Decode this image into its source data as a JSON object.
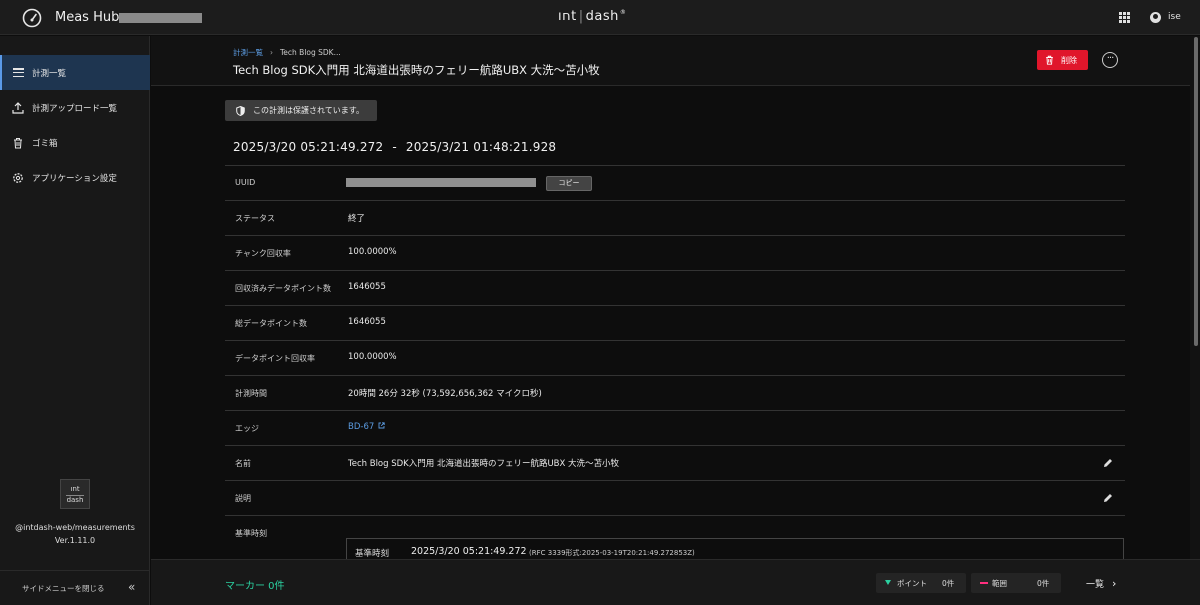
{
  "topbar": {
    "app_title": "Meas Hub",
    "logo_left": "ıחt",
    "logo_right": "dash",
    "user_name": "ise",
    "icons": [
      "gauge-icon",
      "app-grid-icon",
      "user-icon"
    ]
  },
  "sidebar": {
    "items": [
      {
        "label": "計測一覧",
        "icon": "hamburger-icon",
        "active": true
      },
      {
        "label": "計測アップロード一覧",
        "icon": "upload-icon",
        "active": false
      },
      {
        "label": "ゴミ箱",
        "icon": "trash-icon",
        "active": false
      },
      {
        "label": "アプリケーション設定",
        "icon": "gear-icon",
        "active": false
      }
    ],
    "logo_top": "ıחt",
    "logo_bottom": "dash",
    "package": "@intdash-web/measurements",
    "version": "Ver.1.11.0",
    "close_label": "サイドメニューを閉じる",
    "close_icon": "double-chevron-left-icon"
  },
  "header": {
    "breadcrumb_root": "計測一覧",
    "breadcrumb_current": "Tech Blog SDK...",
    "title": "Tech Blog SDK入門用 北海道出張時のフェリー航路UBX 大洗〜苫小牧",
    "delete_label": "削除",
    "more_label": "···"
  },
  "content": {
    "protected_notice": "この計測は保護されています。",
    "period_start": "2025/3/20 05:21:49.272",
    "period_sep": "-",
    "period_end": "2025/3/21 01:48:21.928",
    "rows": [
      {
        "key": "UUID",
        "value": ""
      },
      {
        "key": "ステータス",
        "value": "終了"
      },
      {
        "key": "チャンク回収率",
        "value": "100.0000%"
      },
      {
        "key": "回収済みデータポイント数",
        "value": "1646055"
      },
      {
        "key": "総データポイント数",
        "value": "1646055"
      },
      {
        "key": "データポイント回収率",
        "value": "100.0000%"
      },
      {
        "key": "計測時間",
        "value": "20時間 26分 32秒 (73,592,656,362 マイクロ秒)"
      },
      {
        "key": "エッジ",
        "value": "BD-67"
      },
      {
        "key": "名前",
        "value": "Tech Blog SDK入門用 北海道出張時のフェリー航路UBX 大洗〜苫小牧"
      },
      {
        "key": "説明",
        "value": ""
      },
      {
        "key": "基準時刻",
        "value": ""
      }
    ],
    "copy_label": "コピー",
    "base_time": {
      "label": "基準時刻",
      "value": "2025/3/20 05:21:49.272",
      "rfc": "(RFC 3339形式:2025-03-19T20:21:49.272853Z)"
    }
  },
  "bottombar": {
    "marker_label": "マーカー 0件",
    "point_label": "ポイント",
    "point_count": "0件",
    "range_label": "範囲",
    "range_count": "0件",
    "list_label": "一覧",
    "list_arrow": "›"
  },
  "colors": {
    "accent_blue": "#5b9be0",
    "delete_red": "#e0162b",
    "marker_green": "#2bd0a0",
    "range_pink": "#ff2f7e"
  }
}
